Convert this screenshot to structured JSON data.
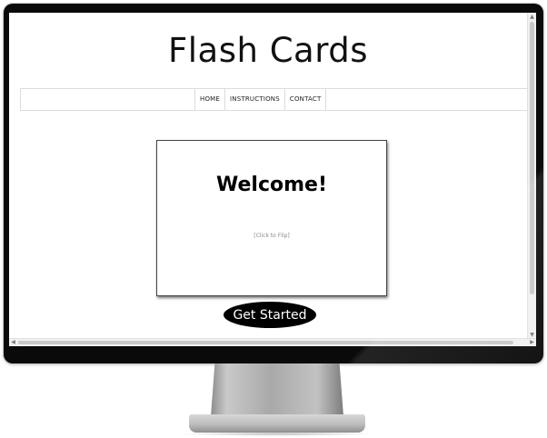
{
  "site": {
    "title": "Flash Cards"
  },
  "nav": {
    "items": [
      "HOME",
      "INSTRUCTIONS",
      "CONTACT"
    ]
  },
  "card": {
    "title": "Welcome!",
    "hint": "[Click to Flip]"
  },
  "cta": {
    "label": "Get Started"
  },
  "colors": {
    "card_border": "#444444",
    "button_bg": "#000000",
    "button_text": "#ffffff",
    "bezel": "#0a0a0a"
  }
}
